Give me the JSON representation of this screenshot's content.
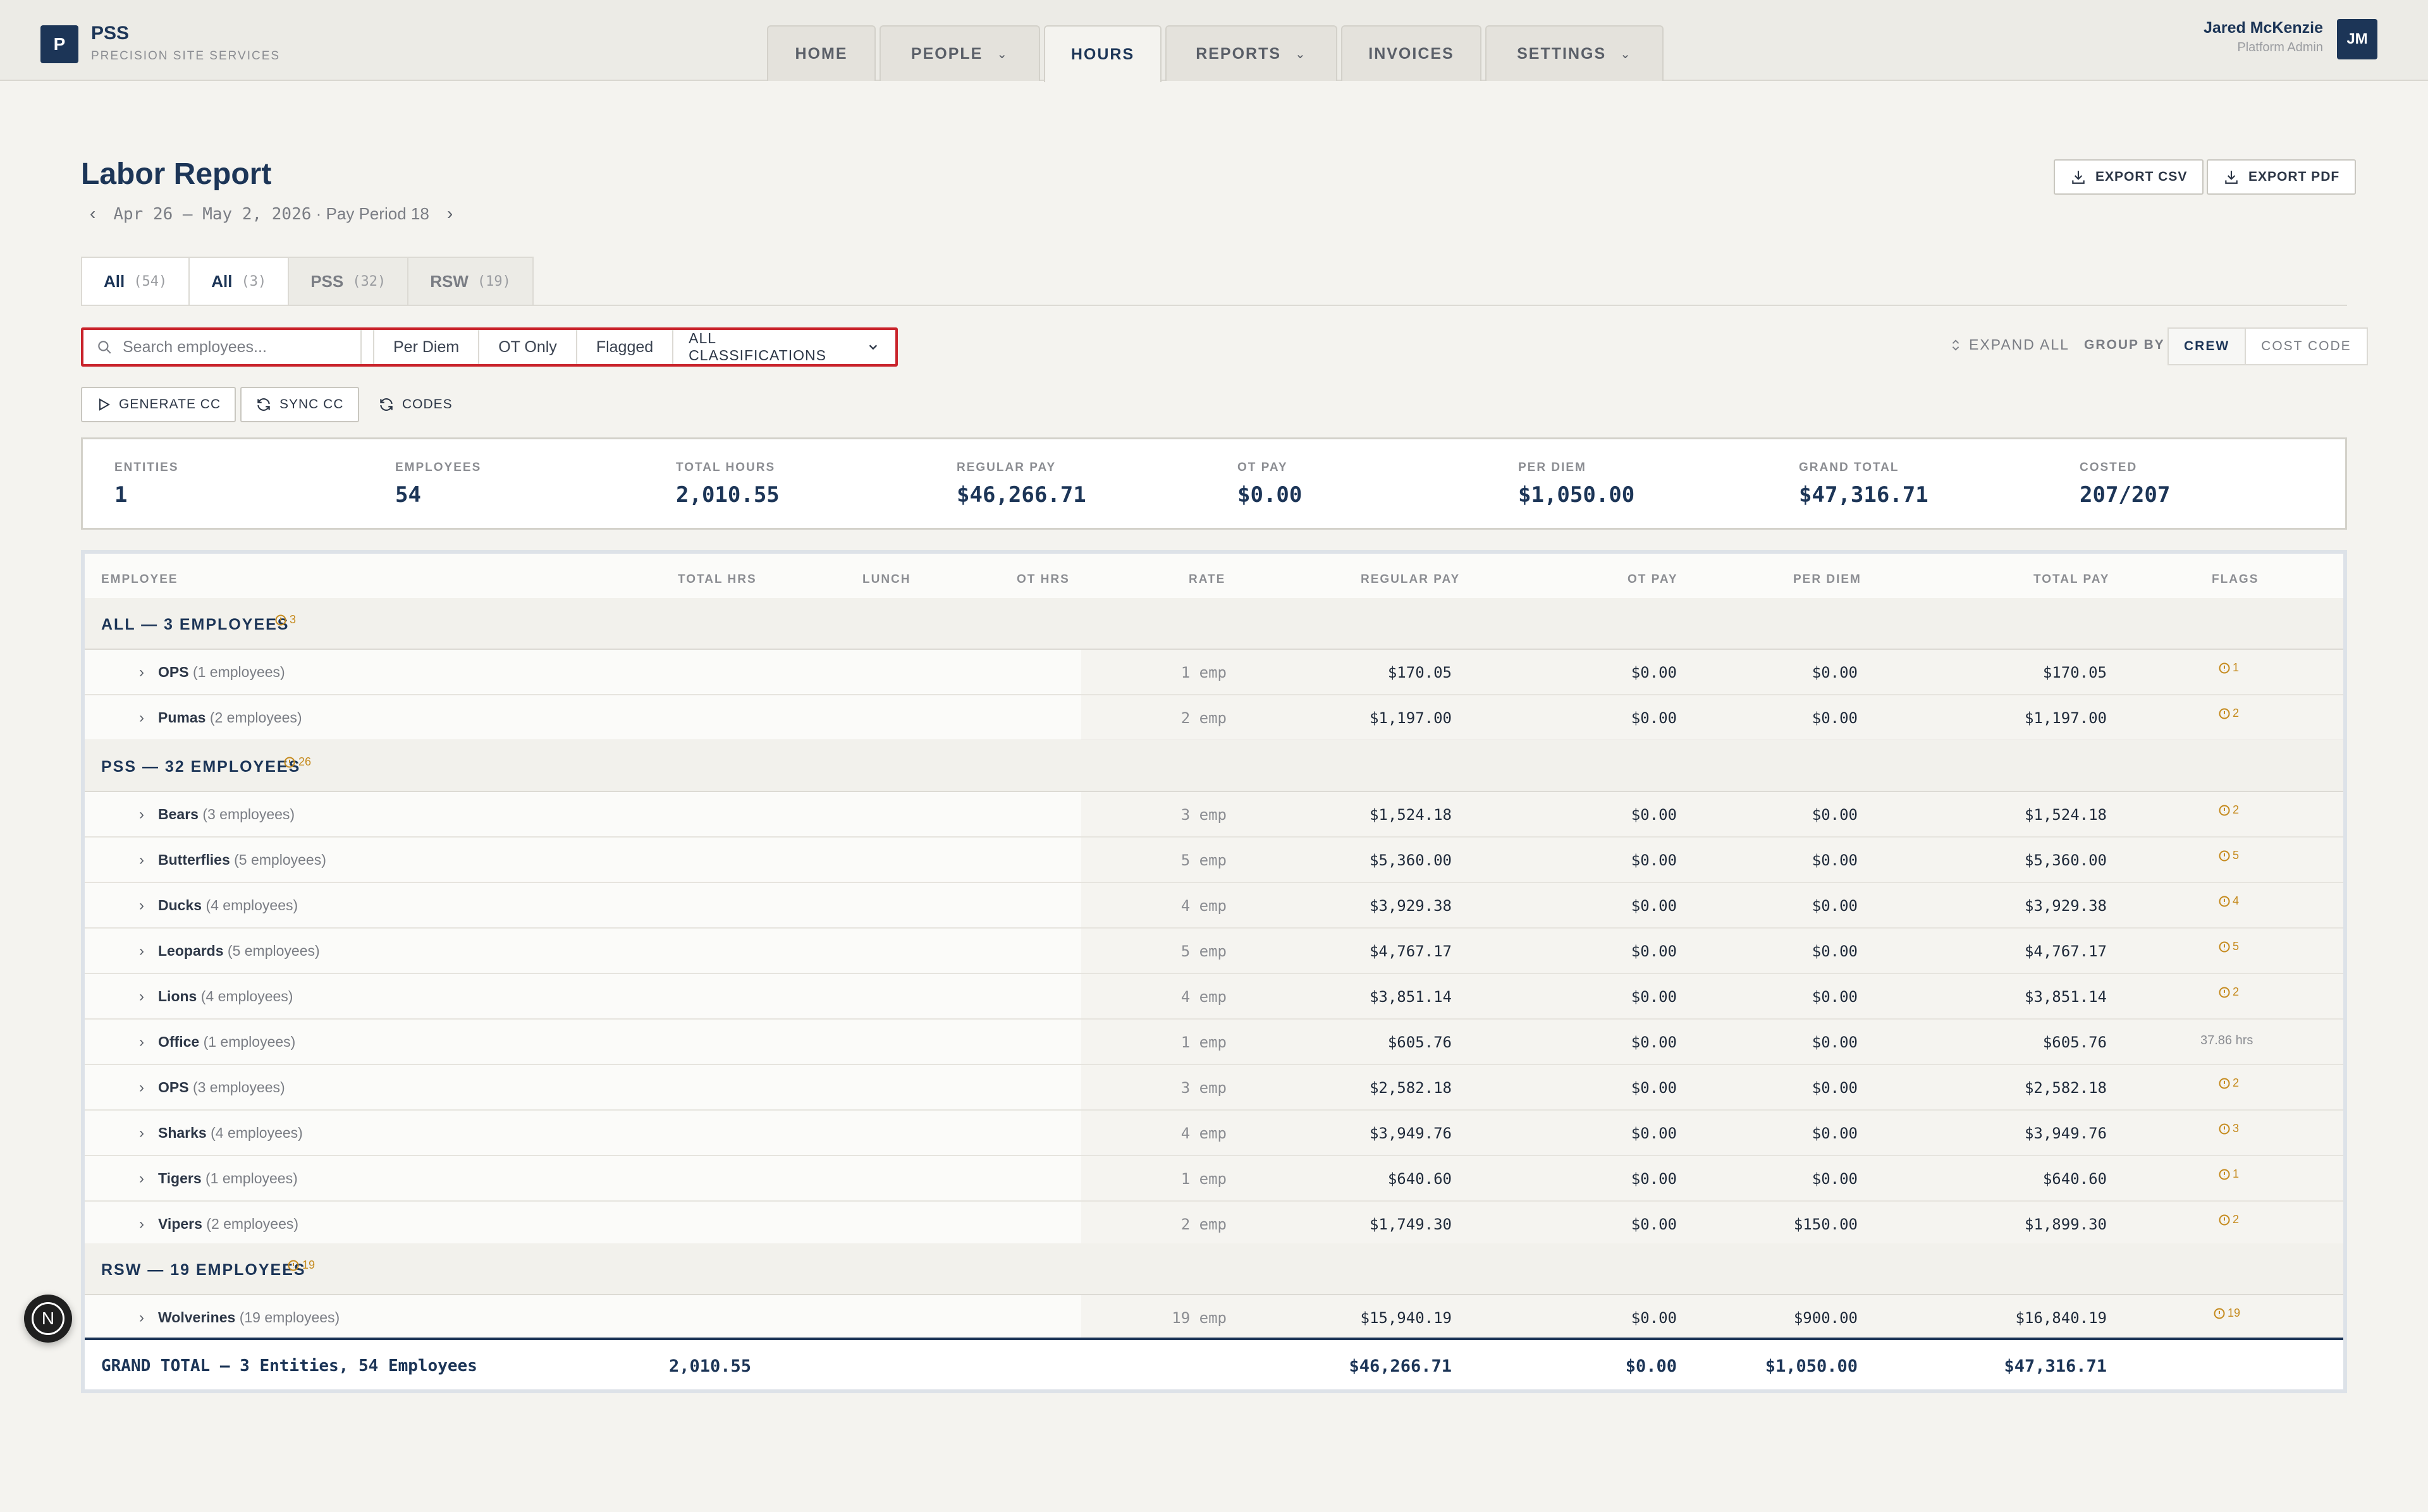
{
  "brand": {
    "logo_letter": "P",
    "name": "PSS",
    "subtitle": "PRECISION SITE SERVICES"
  },
  "nav": [
    {
      "label": "HOME",
      "dropdown": false,
      "active": false
    },
    {
      "label": "PEOPLE",
      "dropdown": true,
      "active": false
    },
    {
      "label": "HOURS",
      "dropdown": false,
      "active": true
    },
    {
      "label": "REPORTS",
      "dropdown": true,
      "active": false
    },
    {
      "label": "INVOICES",
      "dropdown": false,
      "active": false
    },
    {
      "label": "SETTINGS",
      "dropdown": true,
      "active": false
    }
  ],
  "user": {
    "name": "Jared McKenzie",
    "role": "Platform Admin",
    "initials": "JM"
  },
  "page": {
    "title": "Labor Report",
    "period_dates": "Apr 26 – May 2, 2026",
    "period_label": "· Pay Period 18",
    "prev_arrow": "‹",
    "next_arrow": "›",
    "export_csv": "EXPORT CSV",
    "export_pdf": "EXPORT PDF"
  },
  "entity_tabs": [
    {
      "label": "All",
      "count": "(54)",
      "active": true
    },
    {
      "label": "All",
      "count": "(3)",
      "active": true
    },
    {
      "label": "PSS",
      "count": "(32)",
      "active": false
    },
    {
      "label": "RSW",
      "count": "(19)",
      "active": false
    }
  ],
  "filters": {
    "search_placeholder": "Search employees...",
    "per_diem": "Per Diem",
    "ot_only": "OT Only",
    "flagged": "Flagged",
    "classifications": "ALL CLASSIFICATIONS",
    "expand_all": "EXPAND ALL",
    "group_by": "GROUP BY",
    "group_crew": "CREW",
    "group_cost_code": "COST CODE"
  },
  "actions": {
    "generate_cc": "GENERATE CC",
    "sync_cc": "SYNC CC",
    "codes": "CODES"
  },
  "stats": [
    {
      "label": "ENTITIES",
      "value": "1"
    },
    {
      "label": "EMPLOYEES",
      "value": "54"
    },
    {
      "label": "TOTAL HOURS",
      "value": "2,010.55"
    },
    {
      "label": "REGULAR PAY",
      "value": "$46,266.71"
    },
    {
      "label": "OT PAY",
      "value": "$0.00"
    },
    {
      "label": "PER DIEM",
      "value": "$1,050.00"
    },
    {
      "label": "GRAND TOTAL",
      "value": "$47,316.71"
    },
    {
      "label": "COSTED",
      "value": "207/207"
    }
  ],
  "table": {
    "headers": {
      "employee": "EMPLOYEE",
      "total_hrs": "TOTAL HRS",
      "lunch": "LUNCH",
      "ot_hrs": "OT HRS",
      "rate": "RATE",
      "regular_pay": "REGULAR PAY",
      "ot_pay": "OT PAY",
      "per_diem": "PER DIEM",
      "total_pay": "TOTAL PAY",
      "flags": "FLAGS"
    },
    "groups": [
      {
        "name": "ALL — 3 EMPLOYEES",
        "flag": "3",
        "rows": [
          {
            "crew": "OPS",
            "count": "(1 employees)",
            "rate": "1 emp",
            "regular": "$170.05",
            "ot": "$0.00",
            "per_diem": "$0.00",
            "total": "$170.05",
            "flag": "1"
          },
          {
            "crew": "Pumas",
            "count": "(2 employees)",
            "rate": "2 emp",
            "regular": "$1,197.00",
            "ot": "$0.00",
            "per_diem": "$0.00",
            "total": "$1,197.00",
            "flag": "2"
          }
        ]
      },
      {
        "name": "PSS — 32 EMPLOYEES",
        "flag": "26",
        "rows": [
          {
            "crew": "Bears",
            "count": "(3 employees)",
            "rate": "3 emp",
            "regular": "$1,524.18",
            "ot": "$0.00",
            "per_diem": "$0.00",
            "total": "$1,524.18",
            "flag": "2"
          },
          {
            "crew": "Butterflies",
            "count": "(5 employees)",
            "rate": "5 emp",
            "regular": "$5,360.00",
            "ot": "$0.00",
            "per_diem": "$0.00",
            "total": "$5,360.00",
            "flag": "5"
          },
          {
            "crew": "Ducks",
            "count": "(4 employees)",
            "rate": "4 emp",
            "regular": "$3,929.38",
            "ot": "$0.00",
            "per_diem": "$0.00",
            "total": "$3,929.38",
            "flag": "4"
          },
          {
            "crew": "Leopards",
            "count": "(5 employees)",
            "rate": "5 emp",
            "regular": "$4,767.17",
            "ot": "$0.00",
            "per_diem": "$0.00",
            "total": "$4,767.17",
            "flag": "5"
          },
          {
            "crew": "Lions",
            "count": "(4 employees)",
            "rate": "4 emp",
            "regular": "$3,851.14",
            "ot": "$0.00",
            "per_diem": "$0.00",
            "total": "$3,851.14",
            "flag": "2"
          },
          {
            "crew": "Office",
            "count": "(1 employees)",
            "rate": "1 emp",
            "regular": "$605.76",
            "ot": "$0.00",
            "per_diem": "$0.00",
            "total": "$605.76",
            "flag_text": "37.86 hrs"
          },
          {
            "crew": "OPS",
            "count": "(3 employees)",
            "rate": "3 emp",
            "regular": "$2,582.18",
            "ot": "$0.00",
            "per_diem": "$0.00",
            "total": "$2,582.18",
            "flag": "2"
          },
          {
            "crew": "Sharks",
            "count": "(4 employees)",
            "rate": "4 emp",
            "regular": "$3,949.76",
            "ot": "$0.00",
            "per_diem": "$0.00",
            "total": "$3,949.76",
            "flag": "3"
          },
          {
            "crew": "Tigers",
            "count": "(1 employees)",
            "rate": "1 emp",
            "regular": "$640.60",
            "ot": "$0.00",
            "per_diem": "$0.00",
            "total": "$640.60",
            "flag": "1"
          },
          {
            "crew": "Vipers",
            "count": "(2 employees)",
            "rate": "2 emp",
            "regular": "$1,749.30",
            "ot": "$0.00",
            "per_diem": "$150.00",
            "total": "$1,899.30",
            "flag": "2"
          }
        ]
      },
      {
        "name": "RSW — 19 EMPLOYEES",
        "flag": "19",
        "rows": [
          {
            "crew": "Wolverines",
            "count": "(19 employees)",
            "rate": "19 emp",
            "regular": "$15,940.19",
            "ot": "$0.00",
            "per_diem": "$900.00",
            "total": "$16,840.19",
            "flag": "19"
          }
        ]
      }
    ],
    "grand_total": {
      "label": "GRAND TOTAL — 3 Entities, 54 Employees",
      "hours": "2,010.55",
      "regular": "$46,266.71",
      "ot": "$0.00",
      "per_diem": "$1,050.00",
      "total": "$47,316.71"
    }
  },
  "fab_letter": "N",
  "colors": {
    "navy": "#1c3557",
    "accent_red": "#c9232b",
    "flag_amber": "#c58a1d"
  }
}
